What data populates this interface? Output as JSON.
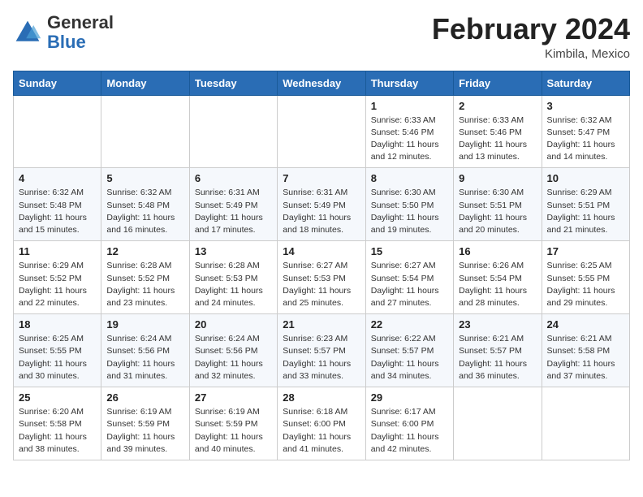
{
  "logo": {
    "general": "General",
    "blue": "Blue"
  },
  "header": {
    "month_year": "February 2024",
    "location": "Kimbila, Mexico"
  },
  "days_of_week": [
    "Sunday",
    "Monday",
    "Tuesday",
    "Wednesday",
    "Thursday",
    "Friday",
    "Saturday"
  ],
  "weeks": [
    [
      {
        "day": "",
        "info": ""
      },
      {
        "day": "",
        "info": ""
      },
      {
        "day": "",
        "info": ""
      },
      {
        "day": "",
        "info": ""
      },
      {
        "day": "1",
        "info": "Sunrise: 6:33 AM\nSunset: 5:46 PM\nDaylight: 11 hours and 12 minutes."
      },
      {
        "day": "2",
        "info": "Sunrise: 6:33 AM\nSunset: 5:46 PM\nDaylight: 11 hours and 13 minutes."
      },
      {
        "day": "3",
        "info": "Sunrise: 6:32 AM\nSunset: 5:47 PM\nDaylight: 11 hours and 14 minutes."
      }
    ],
    [
      {
        "day": "4",
        "info": "Sunrise: 6:32 AM\nSunset: 5:48 PM\nDaylight: 11 hours and 15 minutes."
      },
      {
        "day": "5",
        "info": "Sunrise: 6:32 AM\nSunset: 5:48 PM\nDaylight: 11 hours and 16 minutes."
      },
      {
        "day": "6",
        "info": "Sunrise: 6:31 AM\nSunset: 5:49 PM\nDaylight: 11 hours and 17 minutes."
      },
      {
        "day": "7",
        "info": "Sunrise: 6:31 AM\nSunset: 5:49 PM\nDaylight: 11 hours and 18 minutes."
      },
      {
        "day": "8",
        "info": "Sunrise: 6:30 AM\nSunset: 5:50 PM\nDaylight: 11 hours and 19 minutes."
      },
      {
        "day": "9",
        "info": "Sunrise: 6:30 AM\nSunset: 5:51 PM\nDaylight: 11 hours and 20 minutes."
      },
      {
        "day": "10",
        "info": "Sunrise: 6:29 AM\nSunset: 5:51 PM\nDaylight: 11 hours and 21 minutes."
      }
    ],
    [
      {
        "day": "11",
        "info": "Sunrise: 6:29 AM\nSunset: 5:52 PM\nDaylight: 11 hours and 22 minutes."
      },
      {
        "day": "12",
        "info": "Sunrise: 6:28 AM\nSunset: 5:52 PM\nDaylight: 11 hours and 23 minutes."
      },
      {
        "day": "13",
        "info": "Sunrise: 6:28 AM\nSunset: 5:53 PM\nDaylight: 11 hours and 24 minutes."
      },
      {
        "day": "14",
        "info": "Sunrise: 6:27 AM\nSunset: 5:53 PM\nDaylight: 11 hours and 25 minutes."
      },
      {
        "day": "15",
        "info": "Sunrise: 6:27 AM\nSunset: 5:54 PM\nDaylight: 11 hours and 27 minutes."
      },
      {
        "day": "16",
        "info": "Sunrise: 6:26 AM\nSunset: 5:54 PM\nDaylight: 11 hours and 28 minutes."
      },
      {
        "day": "17",
        "info": "Sunrise: 6:25 AM\nSunset: 5:55 PM\nDaylight: 11 hours and 29 minutes."
      }
    ],
    [
      {
        "day": "18",
        "info": "Sunrise: 6:25 AM\nSunset: 5:55 PM\nDaylight: 11 hours and 30 minutes."
      },
      {
        "day": "19",
        "info": "Sunrise: 6:24 AM\nSunset: 5:56 PM\nDaylight: 11 hours and 31 minutes."
      },
      {
        "day": "20",
        "info": "Sunrise: 6:24 AM\nSunset: 5:56 PM\nDaylight: 11 hours and 32 minutes."
      },
      {
        "day": "21",
        "info": "Sunrise: 6:23 AM\nSunset: 5:57 PM\nDaylight: 11 hours and 33 minutes."
      },
      {
        "day": "22",
        "info": "Sunrise: 6:22 AM\nSunset: 5:57 PM\nDaylight: 11 hours and 34 minutes."
      },
      {
        "day": "23",
        "info": "Sunrise: 6:21 AM\nSunset: 5:57 PM\nDaylight: 11 hours and 36 minutes."
      },
      {
        "day": "24",
        "info": "Sunrise: 6:21 AM\nSunset: 5:58 PM\nDaylight: 11 hours and 37 minutes."
      }
    ],
    [
      {
        "day": "25",
        "info": "Sunrise: 6:20 AM\nSunset: 5:58 PM\nDaylight: 11 hours and 38 minutes."
      },
      {
        "day": "26",
        "info": "Sunrise: 6:19 AM\nSunset: 5:59 PM\nDaylight: 11 hours and 39 minutes."
      },
      {
        "day": "27",
        "info": "Sunrise: 6:19 AM\nSunset: 5:59 PM\nDaylight: 11 hours and 40 minutes."
      },
      {
        "day": "28",
        "info": "Sunrise: 6:18 AM\nSunset: 6:00 PM\nDaylight: 11 hours and 41 minutes."
      },
      {
        "day": "29",
        "info": "Sunrise: 6:17 AM\nSunset: 6:00 PM\nDaylight: 11 hours and 42 minutes."
      },
      {
        "day": "",
        "info": ""
      },
      {
        "day": "",
        "info": ""
      }
    ]
  ]
}
